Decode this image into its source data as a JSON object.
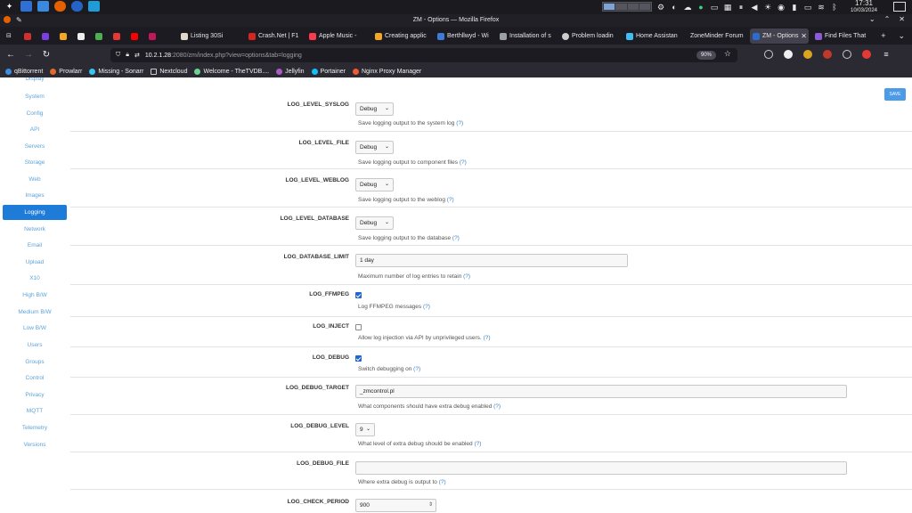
{
  "system_panel": {
    "clock_time": "17:31",
    "clock_date": "10/03/2024"
  },
  "window": {
    "title": "ZM - Options — Mozilla Firefox"
  },
  "tabs": [
    {
      "label": "Listing 30Si",
      "color": "#e0d8c8"
    },
    {
      "label": "Crash.Net | F1",
      "color": "#d7261e"
    },
    {
      "label": "Apple Music -",
      "color": "#fa3c4c"
    },
    {
      "label": "Creating applic",
      "color": "#f5a623"
    },
    {
      "label": "Berthllwyd - Wi",
      "color": "#3e7bd6"
    },
    {
      "label": "Installation of s",
      "color": "#9aa0a6"
    },
    {
      "label": "Problem loadin",
      "color": "#cccccc"
    },
    {
      "label": "Home Assistan",
      "color": "#41bdf5"
    },
    {
      "label": "ZoneMinder Forum",
      "color": "#777777"
    },
    {
      "label": "ZM - Options",
      "color": "#2b6cd1"
    },
    {
      "label": "Find Files That",
      "color": "#8a5cd8"
    }
  ],
  "address_bar": {
    "url_host": "10.2.1.28",
    "url_rest": ":2080/zm/index.php?view=options&tab=logging",
    "zoom": "90%"
  },
  "bookmarks": [
    {
      "label": "qBittorrent",
      "color": "#3c8de0"
    },
    {
      "label": "Prowlarr",
      "color": "#e06a2a"
    },
    {
      "label": "Missing - Sonarr",
      "color": "#35c5f0"
    },
    {
      "label": "Nextcloud",
      "color": "#0082c9"
    },
    {
      "label": "Welcome - TheTVDB....",
      "color": "#6cd491"
    },
    {
      "label": "Jellyfin",
      "color": "#aa5cc3"
    },
    {
      "label": "Portainer",
      "color": "#13bef9"
    },
    {
      "label": "Nginx Proxy Manager",
      "color": "#f15833"
    }
  ],
  "sidebar": {
    "items": [
      {
        "label": "Display"
      },
      {
        "label": "System"
      },
      {
        "label": "Config"
      },
      {
        "label": "API"
      },
      {
        "label": "Servers"
      },
      {
        "label": "Storage"
      },
      {
        "label": "Web"
      },
      {
        "label": "Images"
      },
      {
        "label": "Logging"
      },
      {
        "label": "Network"
      },
      {
        "label": "Email"
      },
      {
        "label": "Upload"
      },
      {
        "label": "X10"
      },
      {
        "label": "High B/W"
      },
      {
        "label": "Medium B/W"
      },
      {
        "label": "Low B/W"
      },
      {
        "label": "Users"
      },
      {
        "label": "Groups"
      },
      {
        "label": "Control"
      },
      {
        "label": "Privacy"
      },
      {
        "label": "MQTT"
      },
      {
        "label": "Telemetry"
      },
      {
        "label": "Versions"
      }
    ],
    "active": "Logging"
  },
  "save_label": "SAVE",
  "options": [
    {
      "name": "LOG_LEVEL_SYSLOG",
      "type": "select",
      "value": "Debug",
      "help": "Save logging output to the system log",
      "help_link": "(?)"
    },
    {
      "name": "LOG_LEVEL_FILE",
      "type": "select",
      "value": "Debug",
      "help": "Save logging output to component files",
      "help_link": "(?)"
    },
    {
      "name": "LOG_LEVEL_WEBLOG",
      "type": "select",
      "value": "Debug",
      "help": "Save logging output to the weblog",
      "help_link": "(?)"
    },
    {
      "name": "LOG_LEVEL_DATABASE",
      "type": "select",
      "value": "Debug",
      "help": "Save logging output to the database",
      "help_link": "(?)"
    },
    {
      "name": "LOG_DATABASE_LIMIT",
      "type": "text",
      "value": "1 day",
      "help": "Maximum number of log entries to retain",
      "help_link": "(?)"
    },
    {
      "name": "LOG_FFMPEG",
      "type": "checkbox",
      "checked": true,
      "help": "Log FFMPEG messages",
      "help_link": "(?)"
    },
    {
      "name": "LOG_INJECT",
      "type": "checkbox",
      "checked": false,
      "help": "Allow log injection via API by unprivileged users.",
      "help_link": "(?)"
    },
    {
      "name": "LOG_DEBUG",
      "type": "checkbox",
      "checked": true,
      "help": "Switch debugging on",
      "help_link": "(?)"
    },
    {
      "name": "LOG_DEBUG_TARGET",
      "type": "text",
      "value": "_zmcontrol.pl",
      "help": "What components should have extra debug enabled",
      "help_link": "(?)"
    },
    {
      "name": "LOG_DEBUG_LEVEL",
      "type": "select",
      "value": "9",
      "help": "What level of extra debug should be enabled",
      "help_link": "(?)"
    },
    {
      "name": "LOG_DEBUG_FILE",
      "type": "text",
      "value": "",
      "help": "Where extra debug is output to",
      "help_link": "(?)"
    },
    {
      "name": "LOG_CHECK_PERIOD",
      "type": "number",
      "value": "900",
      "help": "",
      "help_link": ""
    }
  ]
}
